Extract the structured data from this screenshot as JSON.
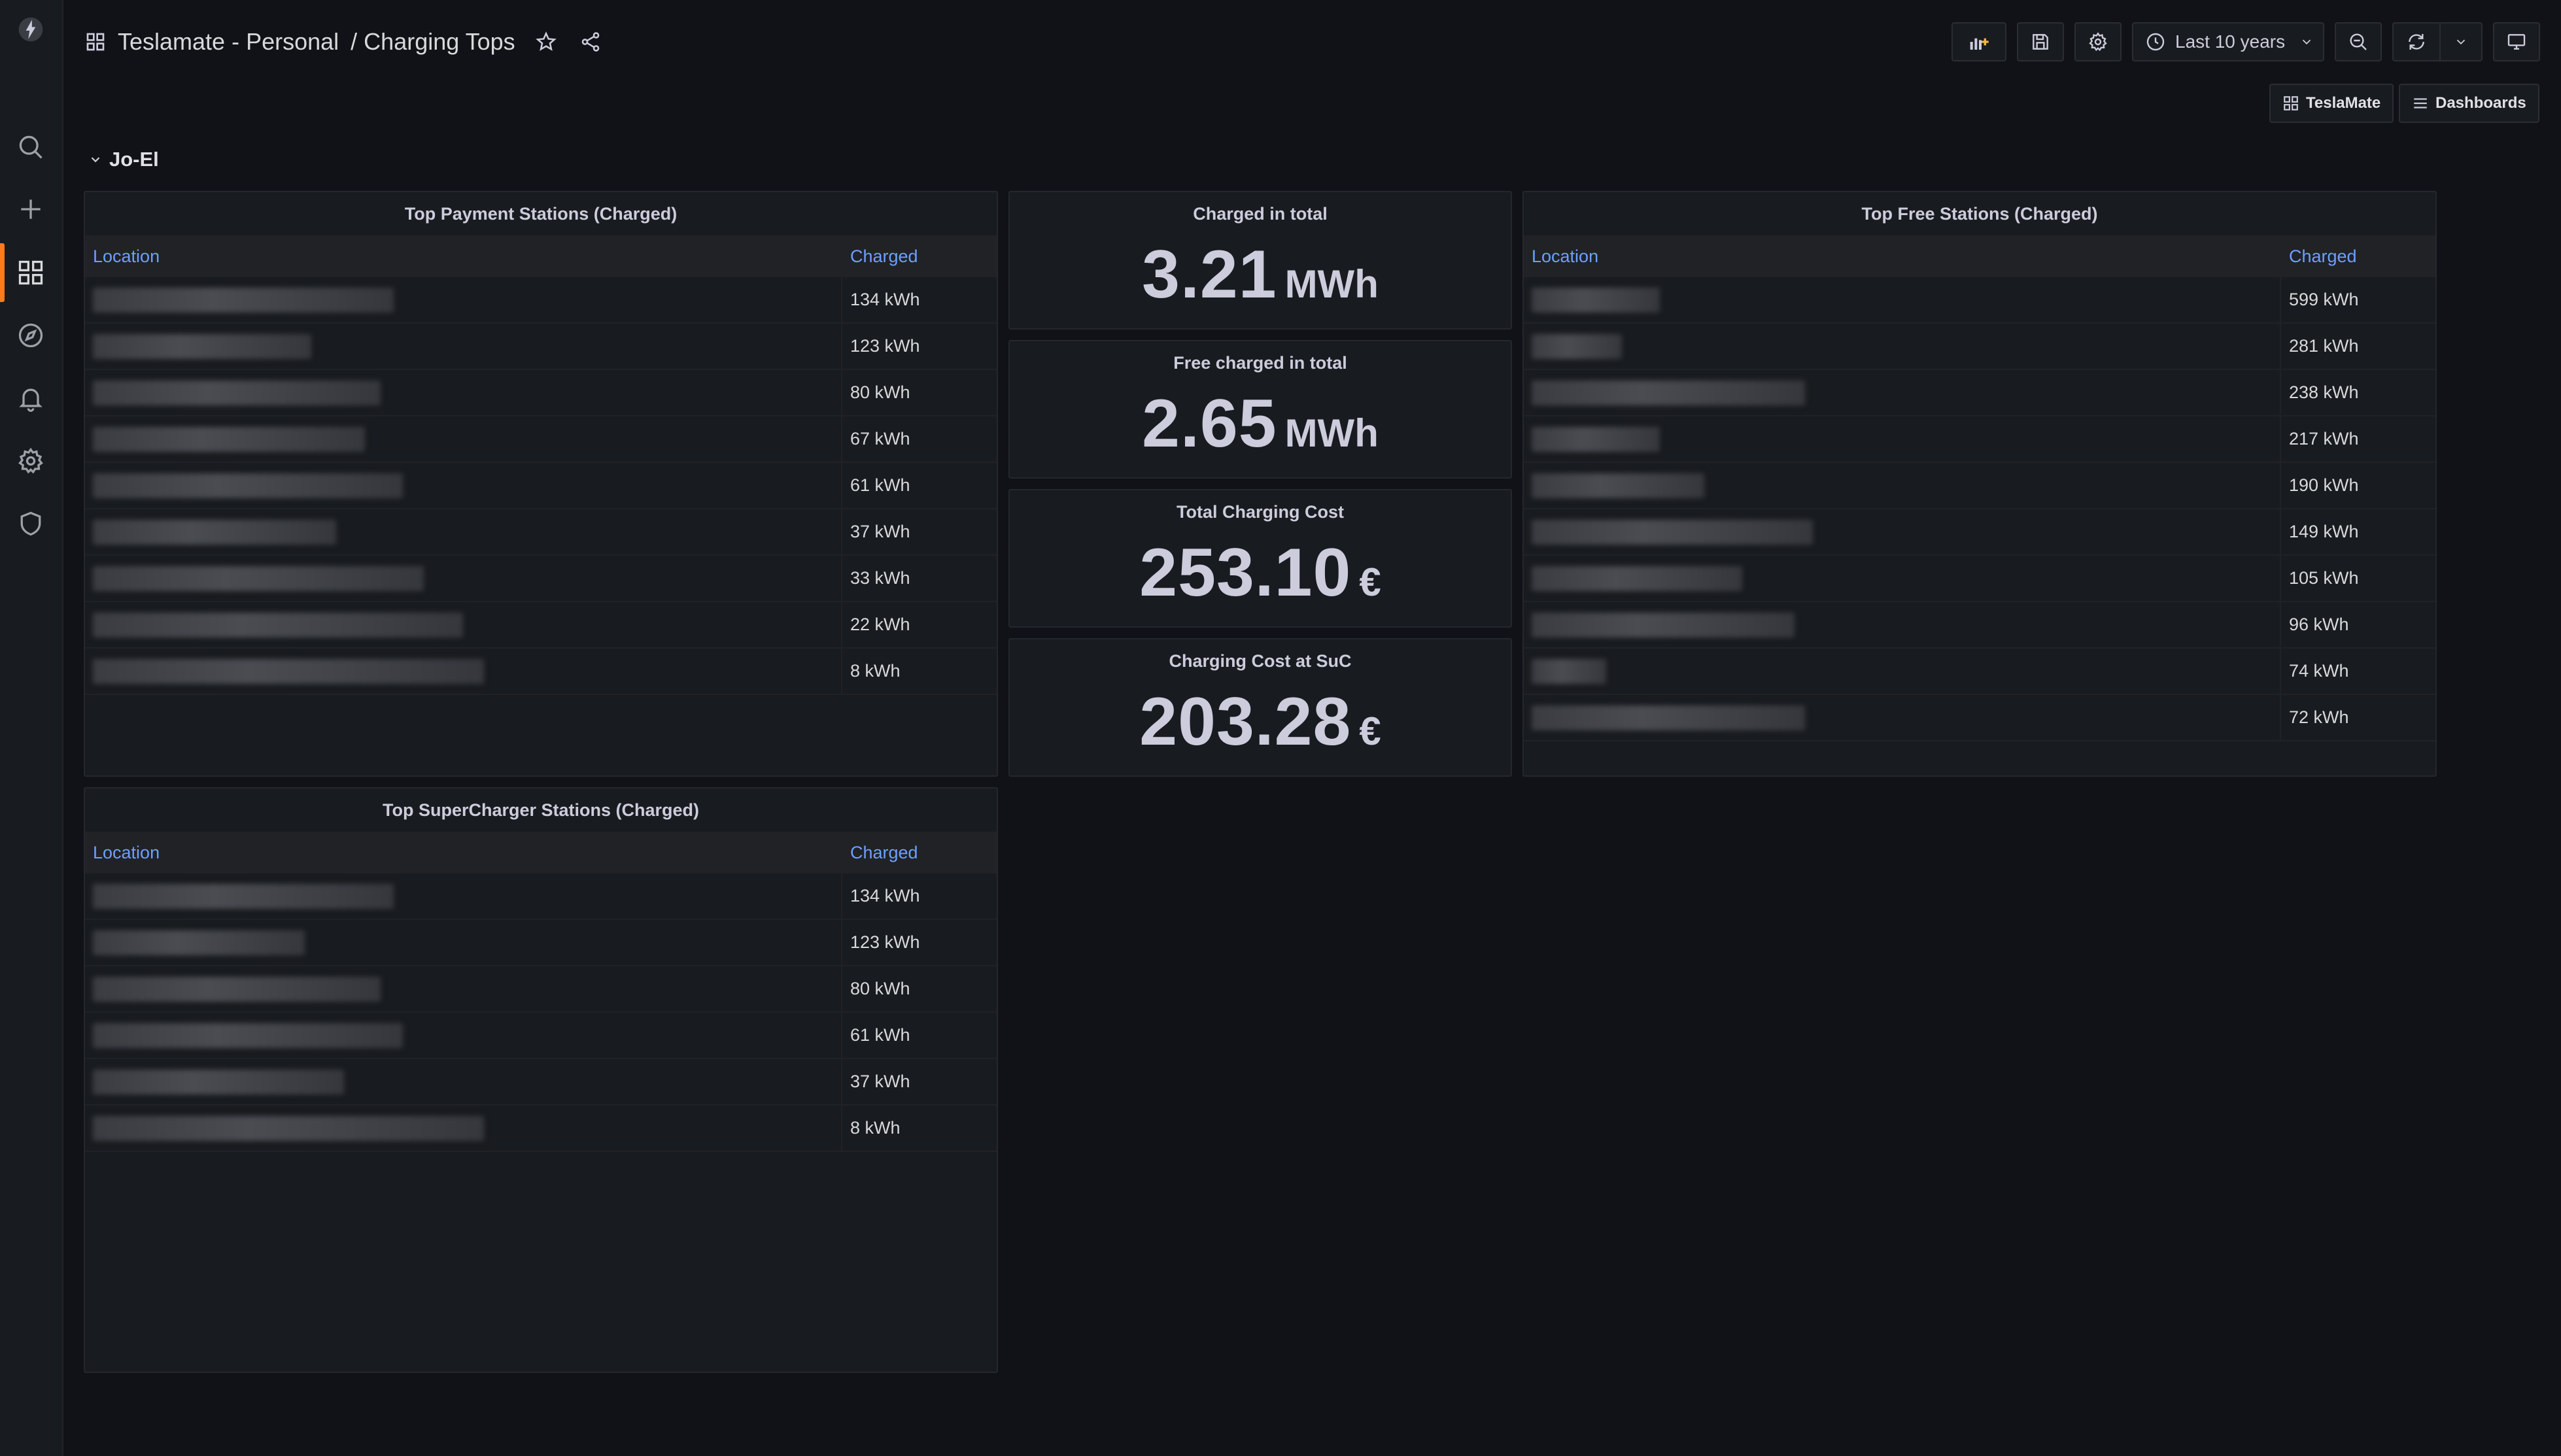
{
  "header": {
    "folder": "Teslamate - Personal",
    "separator": "/",
    "dashboard": "Charging Tops",
    "time_range": "Last 10 years"
  },
  "links": {
    "teslamate": "TeslaMate",
    "dashboards": "Dashboards"
  },
  "row": {
    "title": "Jo-El"
  },
  "payment": {
    "title": "Top Payment Stations (Charged)",
    "col_location": "Location",
    "col_charged": "Charged",
    "rows": [
      "134 kWh",
      "123 kWh",
      "80 kWh",
      "67 kWh",
      "61 kWh",
      "37 kWh",
      "33 kWh",
      "22 kWh",
      "8 kWh"
    ]
  },
  "stats": [
    {
      "title": "Charged in total",
      "value": "3.21",
      "unit": "MWh"
    },
    {
      "title": "Free charged in total",
      "value": "2.65",
      "unit": "MWh"
    },
    {
      "title": "Total Charging Cost",
      "value": "253.10",
      "unit": "€"
    },
    {
      "title": "Charging Cost at SuC",
      "value": "203.28",
      "unit": "€"
    }
  ],
  "free": {
    "title": "Top Free Stations (Charged)",
    "col_location": "Location",
    "col_charged": "Charged",
    "rows": [
      "599 kWh",
      "281 kWh",
      "238 kWh",
      "217 kWh",
      "190 kWh",
      "149 kWh",
      "105 kWh",
      "96 kWh",
      "74 kWh",
      "72 kWh"
    ]
  },
  "super": {
    "title": "Top SuperCharger Stations (Charged)",
    "col_location": "Location",
    "col_charged": "Charged",
    "rows": [
      "134 kWh",
      "123 kWh",
      "80 kWh",
      "61 kWh",
      "37 kWh",
      "8 kWh"
    ]
  },
  "colors": {
    "accent": "#ff7a1a",
    "link": "#6e9fff",
    "background": "#111217",
    "panel": "#181b1f"
  }
}
